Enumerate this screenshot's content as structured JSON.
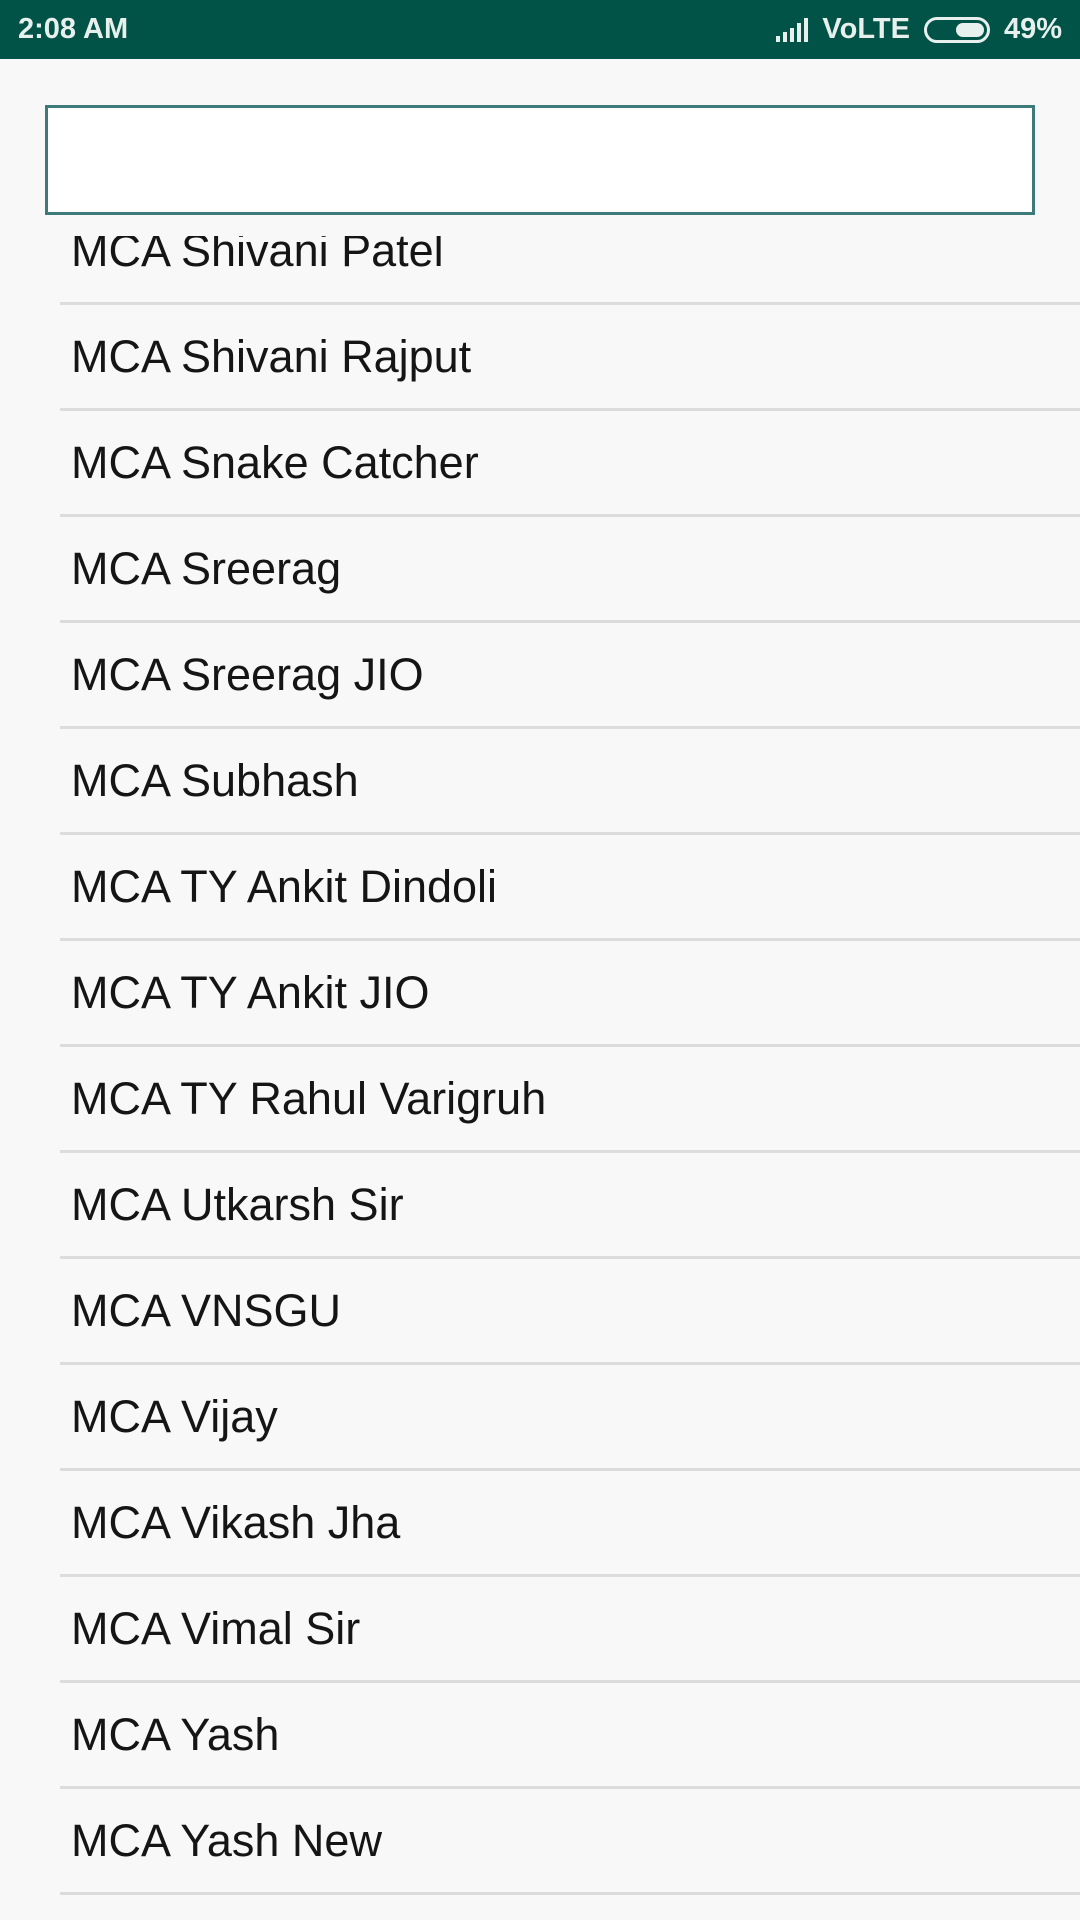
{
  "status_bar": {
    "time": "2:08 AM",
    "network": "VoLTE",
    "battery_percent": "49%",
    "battery_level": 0.49
  },
  "search": {
    "value": "",
    "placeholder": ""
  },
  "contacts": [
    "MCA Shivani Patel",
    "MCA Shivani Rajput",
    "MCA Snake Catcher",
    "MCA Sreerag",
    "MCA Sreerag JIO",
    "MCA Subhash",
    "MCA TY Ankit Dindoli",
    "MCA TY Ankit JIO",
    "MCA TY Rahul Varigruh",
    "MCA Utkarsh Sir",
    "MCA VNSGU",
    "MCA Vijay",
    "MCA Vikash Jha",
    "MCA Vimal Sir",
    "MCA Yash",
    "MCA Yash New"
  ]
}
